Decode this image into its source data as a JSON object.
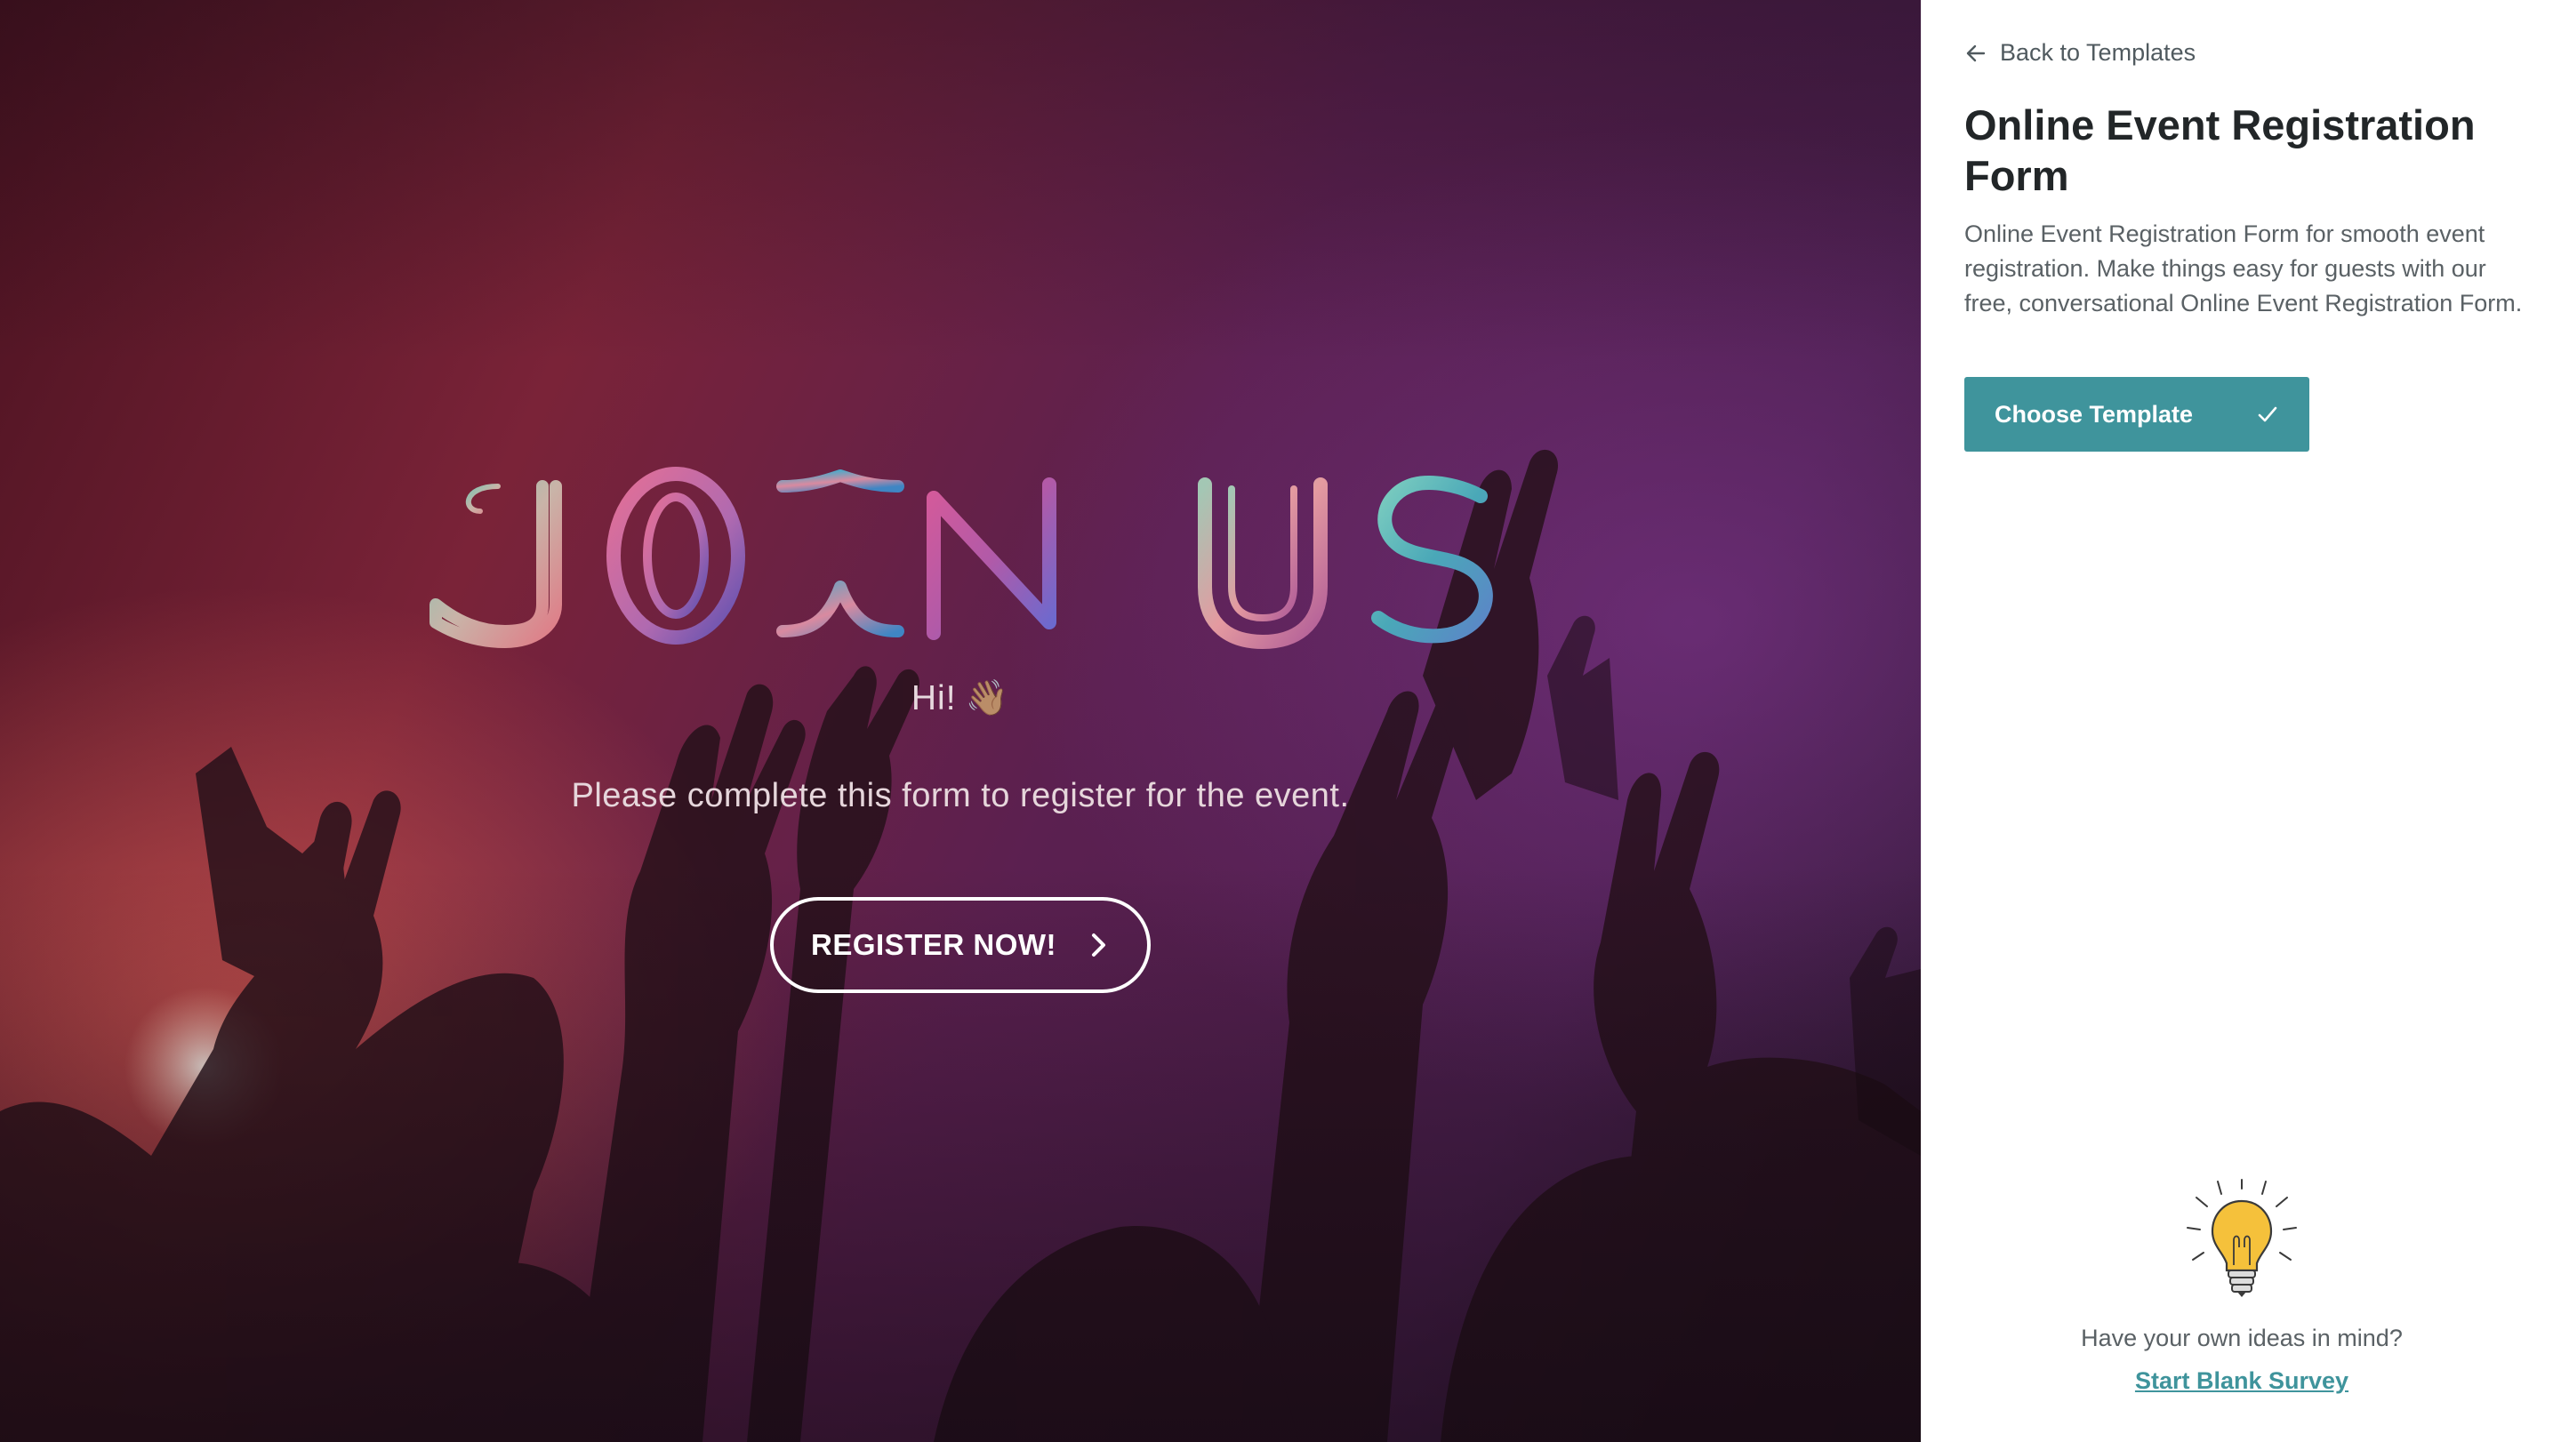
{
  "preview": {
    "title": "JOIN US",
    "greeting": "Hi!",
    "greeting_emoji": "👋🏽",
    "subtitle": "Please complete this form to register for the event.",
    "register_button": "REGISTER NOW!"
  },
  "panel": {
    "back_label": "Back to Templates",
    "title": "Online Event Registration Form",
    "description": "Online Event Registration Form for smooth event registration. Make things easy for guests with our free, conversational Online Event Registration Form.",
    "choose_label": "Choose Template",
    "ideas_text": "Have your own ideas in mind?",
    "blank_link": "Start Blank Survey"
  },
  "colors": {
    "accent": "#3f949c",
    "title_text": "#222628"
  }
}
